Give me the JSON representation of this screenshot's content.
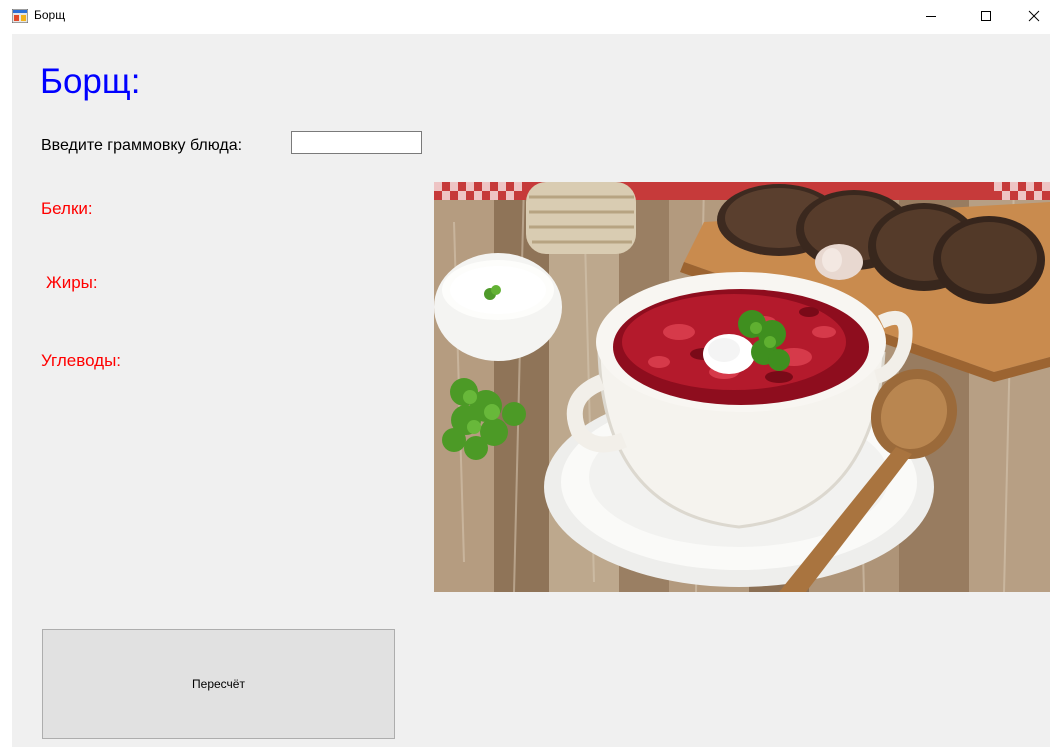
{
  "window": {
    "title": "Борщ",
    "icon": "windows-form-icon",
    "controls": [
      "minimize-icon",
      "maximize-icon",
      "close-icon"
    ]
  },
  "form": {
    "heading": "Борщ:",
    "gram_prompt": "Введите граммовку блюда:",
    "gram_input_value": "",
    "labels": {
      "protein": "Белки:",
      "fat": "Жиры:",
      "carbs": "Углеводы:"
    },
    "recalc_button_label": "Пересчёт"
  },
  "colors": {
    "heading": "#0000ff",
    "nutrient_labels": "#ff0000",
    "form_background": "#f0f0f0"
  }
}
